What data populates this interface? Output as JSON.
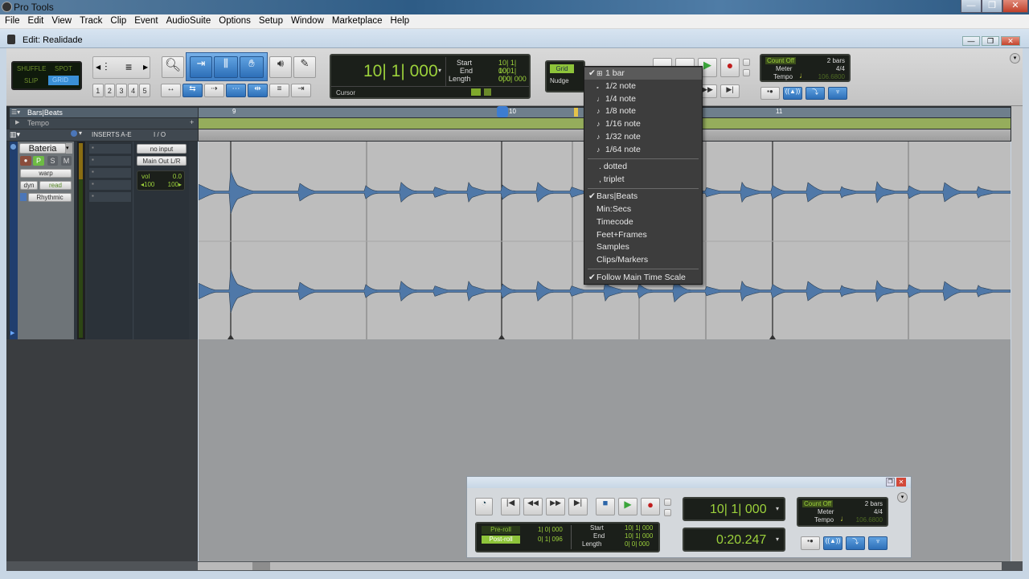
{
  "app": {
    "title": "Pro Tools",
    "window_title": "Edit: Realidade"
  },
  "window_controls": {
    "minimize": "—",
    "restore": "❐",
    "close": "✕"
  },
  "menu": [
    "File",
    "Edit",
    "View",
    "Track",
    "Clip",
    "Event",
    "AudioSuite",
    "Options",
    "Setup",
    "Window",
    "Marketplace",
    "Help"
  ],
  "edit_modes": {
    "shuffle": "SHUFFLE",
    "spot": "SPOT",
    "slip": "SLIP",
    "grid": "GRID",
    "active": "GRID"
  },
  "zoom_presets": [
    "1",
    "2",
    "3",
    "4",
    "5"
  ],
  "counter": {
    "main": "10| 1| 000",
    "start_label": "Start",
    "start": "10| 1| 000",
    "end_label": "End",
    "end": "10| 1| 000",
    "length_label": "Length",
    "length": "0| 0| 000",
    "cursor_label": "Cursor"
  },
  "grid_nudge": {
    "grid_label": "Grid",
    "nudge_label": "Nudge"
  },
  "grid_menu": {
    "items": [
      {
        "label": "1 bar",
        "checked": true,
        "icon": "bar-icon"
      },
      {
        "label": "1/2 note",
        "icon": "half-note-icon"
      },
      {
        "label": "1/4 note",
        "icon": "quarter-note-icon"
      },
      {
        "label": "1/8 note",
        "icon": "eighth-note-icon"
      },
      {
        "label": "1/16 note",
        "icon": "sixteenth-note-icon"
      },
      {
        "label": "1/32 note",
        "icon": "thirtysecond-note-icon"
      },
      {
        "label": "1/64 note",
        "icon": "sixtyfourth-note-icon"
      }
    ],
    "modifiers": [
      {
        "label": ". dotted"
      },
      {
        "label": ", triplet"
      }
    ],
    "timebases": [
      {
        "label": "Bars|Beats",
        "checked": true
      },
      {
        "label": "Min:Secs"
      },
      {
        "label": "Timecode"
      },
      {
        "label": "Feet+Frames"
      },
      {
        "label": "Samples"
      },
      {
        "label": "Clips/Markers"
      }
    ],
    "follow": {
      "label": "Follow Main Time Scale",
      "checked": true
    }
  },
  "midi_panel": {
    "count_off": "Count Off",
    "bars": "2 bars",
    "meter_label": "Meter",
    "meter": "4/4",
    "tempo_label": "Tempo",
    "tempo": "106.6800"
  },
  "rulers": {
    "bars_beats": "Bars|Beats",
    "tempo": "Tempo",
    "markers": [
      "9",
      "10",
      "11"
    ]
  },
  "track_header": {
    "inserts": "INSERTS A-E",
    "io": "I / O"
  },
  "track": {
    "name": "Bateria",
    "rec": "●",
    "playlist": "P",
    "solo": "S",
    "mute": "M",
    "view": "warp",
    "dyn": "dyn",
    "automation": "read",
    "elastic": "Rhythmic",
    "input": "no input",
    "output": "Main Out L/R",
    "vol_label": "vol",
    "vol": "0.0",
    "pan_left": "◂100",
    "pan_right": "100▸"
  },
  "transport": {
    "preroll_label": "Pre-roll",
    "preroll": "1| 0| 000",
    "postroll_label": "Post-roll",
    "postroll": "0| 1| 096",
    "start_label": "Start",
    "start": "10| 1| 000",
    "end_label": "End",
    "end": "10| 1| 000",
    "length_label": "Length",
    "length": "0| 0| 000",
    "main_counter": "10| 1| 000",
    "sub_counter": "0:20.247",
    "count_off": "Count Off",
    "bars": "2 bars",
    "meter_label": "Meter",
    "meter": "4/4",
    "tempo_label": "Tempo",
    "tempo": "106.6800"
  }
}
